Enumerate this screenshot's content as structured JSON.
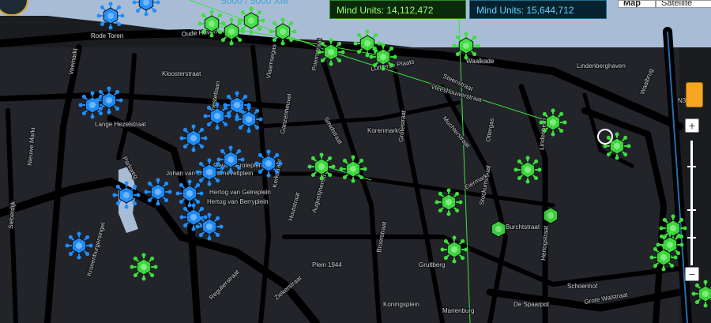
{
  "header": {
    "xm_text": "5000 / 5000 XM",
    "mind_units_enlightened": "Mind Units: 14,112,472",
    "mind_units_resistance": "Mind Units: 15,644,712"
  },
  "map_controls": {
    "map_label": "Map",
    "satellite_label": "Satellite",
    "zoom_in": "+",
    "zoom_out": "−"
  },
  "colors": {
    "enlightened": "#3ee03e",
    "resistance": "#1f8fff",
    "water": "#a9bcd6",
    "road": "#000000",
    "block": "#2a2c31"
  },
  "street_labels": [
    "Rode Toren",
    "Oude Haven",
    "Veemarkt",
    "Kloosterstraat",
    "Lange Hezelstraat",
    "Parkweg",
    "Johan van Oldenbarneveltplein",
    "Gerard Groteplein",
    "Hertog van Gelreplein",
    "Hertog van Berryplein",
    "Smidstraat",
    "Korenmarkt",
    "Grotestraat",
    "Muchterstraat",
    "Steenstraat",
    "Vleeshouwerstraat",
    "Waalkade",
    "Lindenberghaven",
    "Lindenberg",
    "Stockumstraat",
    "Hertogstraat",
    "Schoenhof",
    "Grote Walstraat",
    "Nieuwe Markt",
    "Sieberdijk",
    "Augustijnenstraat",
    "Plein 1944",
    "Koningsplein",
    "Broerstraat",
    "Gruitberg",
    "Marienburg",
    "De Spaarpot",
    "Kronenburgersingel",
    "Regulierstraat",
    "Ziekerstraat",
    "Houtstraat",
    "Eiermarkt",
    "Kerkstraat",
    "Genestetlaan",
    "Waalbrug",
    "Priemstraat",
    "Lutherse Plaats",
    "Ganzenheuvel",
    "Burchtstraat",
    "Vlaamsegas",
    "Ottergas",
    "N3"
  ]
}
